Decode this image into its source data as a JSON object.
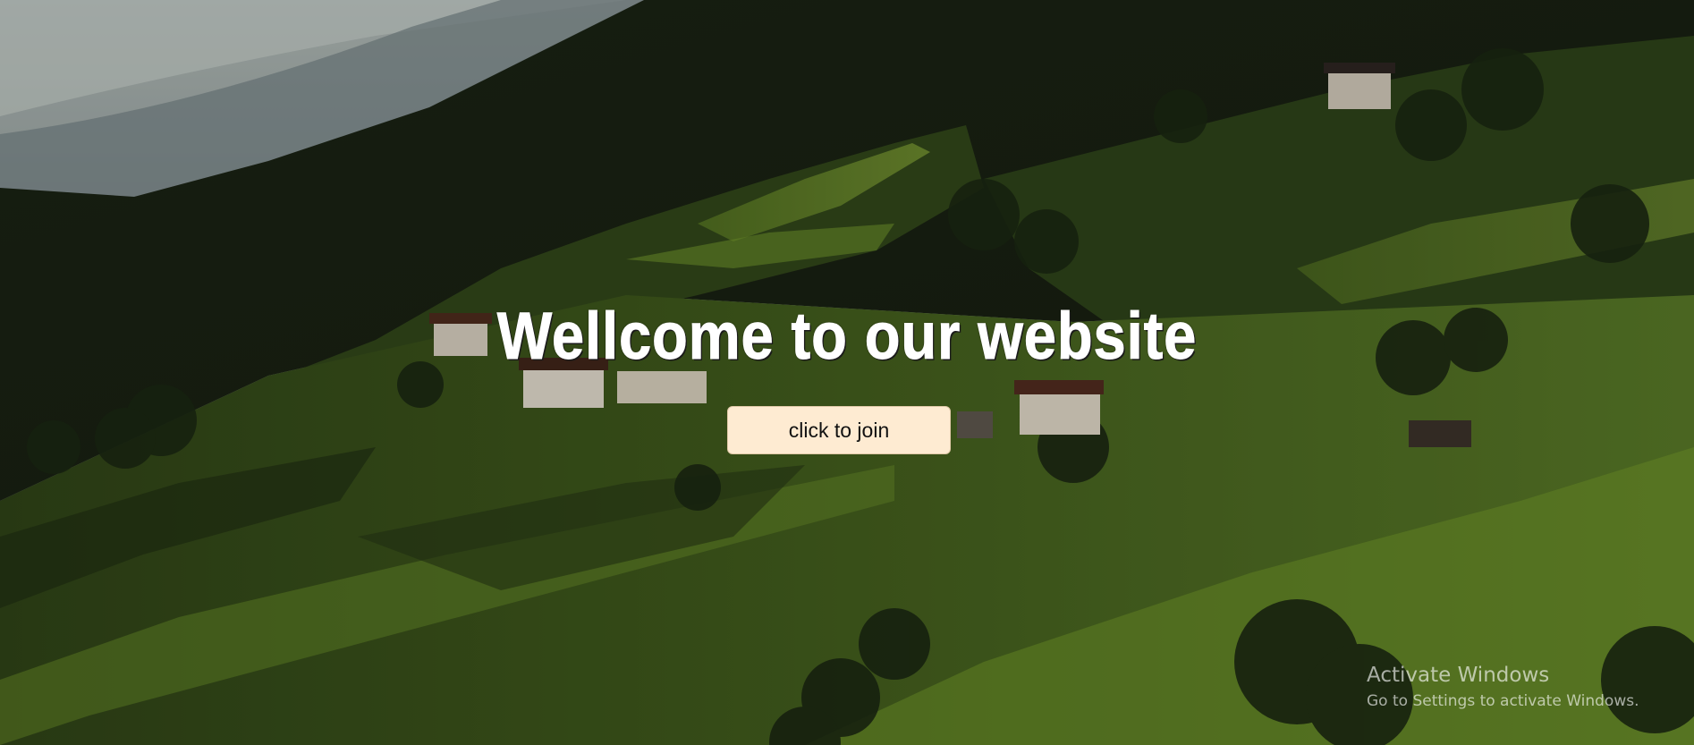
{
  "hero": {
    "headline": "Wellcome to our website",
    "button_label": "click to join"
  },
  "os_watermark": {
    "title": "Activate Windows",
    "subtitle": "Go to Settings to activate Windows."
  },
  "colors": {
    "button_bg": "#feebd2",
    "headline_text": "#ffffff",
    "background_dominant": "#2b3c16"
  }
}
